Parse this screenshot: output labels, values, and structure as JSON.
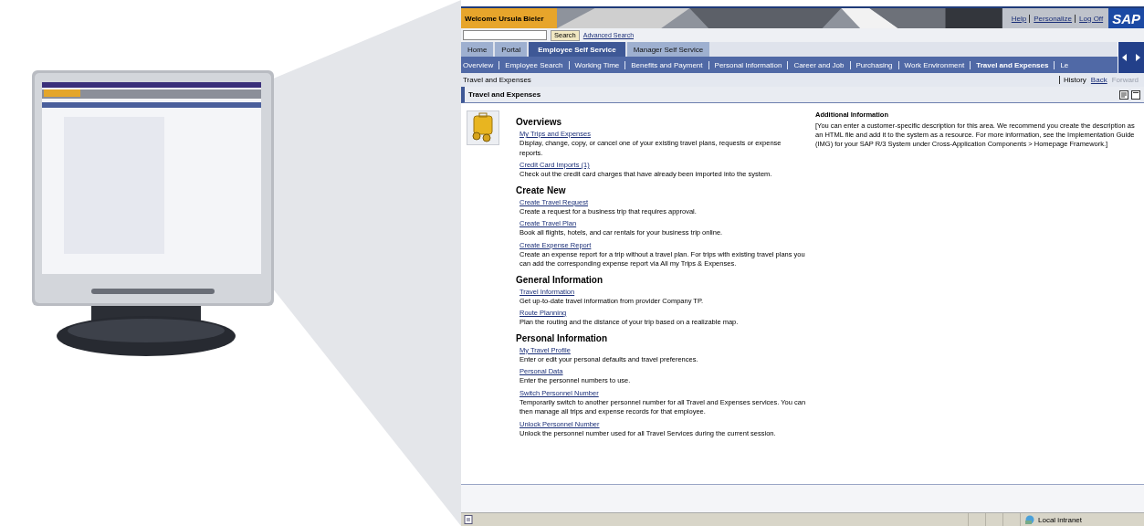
{
  "header": {
    "welcome": "Welcome Ursula Bieler",
    "links": [
      "Help",
      "Personalize",
      "Log Off"
    ],
    "logo": "SAP"
  },
  "search": {
    "button": "Search",
    "link": "Advanced Search"
  },
  "tabs": [
    {
      "label": "Home",
      "selected": false
    },
    {
      "label": "Portal",
      "selected": false
    },
    {
      "label": "Employee Self Service",
      "selected": true
    },
    {
      "label": "Manager Self Service",
      "selected": false
    }
  ],
  "subnav": [
    {
      "label": "Overview",
      "selected": false
    },
    {
      "label": "Employee Search",
      "selected": false
    },
    {
      "label": "Working Time",
      "selected": false
    },
    {
      "label": "Benefits and Payment",
      "selected": false
    },
    {
      "label": "Personal Information",
      "selected": false
    },
    {
      "label": "Career and Job",
      "selected": false
    },
    {
      "label": "Purchasing",
      "selected": false
    },
    {
      "label": "Work Environment",
      "selected": false
    },
    {
      "label": "Travel and Expenses",
      "selected": true
    },
    {
      "label": "Le",
      "selected": false
    }
  ],
  "breadcrumb": {
    "title": "Travel and Expenses",
    "history": "History",
    "nav": [
      {
        "label": "Back",
        "disabled": false
      },
      {
        "label": "Forward",
        "disabled": true
      }
    ]
  },
  "pane": {
    "title": "Travel and Expenses"
  },
  "sections": [
    {
      "heading": "Overviews",
      "items": [
        {
          "link": "My Trips and Expenses",
          "description": "Display, change, copy, or cancel one of your existing travel plans, requests or expense reports."
        },
        {
          "link": "Credit Card Imports (1)",
          "description": "Check out the credit card charges that have already been imported into the system."
        }
      ]
    },
    {
      "heading": "Create New",
      "items": [
        {
          "link": "Create Travel Request",
          "description": "Create a request for a business trip that requires approval."
        },
        {
          "link": "Create Travel Plan",
          "description": "Book all flights, hotels, and car rentals for your business trip online."
        },
        {
          "link": "Create Expense Report",
          "description": "Create an expense report for a trip without a travel plan. For trips with existing travel plans you can add the corresponding expense report via All my Trips & Expenses."
        }
      ]
    },
    {
      "heading": "General Information",
      "items": [
        {
          "link": "Travel Information",
          "description": "Get up-to-date travel information from provider Company TP."
        },
        {
          "link": "Route Planning",
          "description": "Plan the routing and the distance of your trip based on a realizable map."
        }
      ]
    },
    {
      "heading": "Personal Information",
      "items": [
        {
          "link": "My Travel Profile",
          "description": "Enter or edit your personal defaults and travel preferences."
        },
        {
          "link": "Personal Data",
          "description": "Enter the personnel numbers to use."
        },
        {
          "link": "Switch Personnel Number",
          "description": "Temporarily switch to another personnel number for all Travel and Expenses services. You can then manage all trips and expense records for that employee."
        },
        {
          "link": "Unlock Personnel Number",
          "description": "Unlock the personnel number used for all Travel Services during the current session."
        }
      ]
    }
  ],
  "additional": {
    "heading": "Additional Information",
    "text": "[You can enter a customer-specific description for this area. We recommend you create the description as an HTML file and add it to the system as a resource. For more information, see the Implementation Guide (IMG) for your SAP R/3 System under Cross-Application Components > Homepage Framework.]"
  },
  "status_bar": {
    "zone": "Local intranet"
  }
}
